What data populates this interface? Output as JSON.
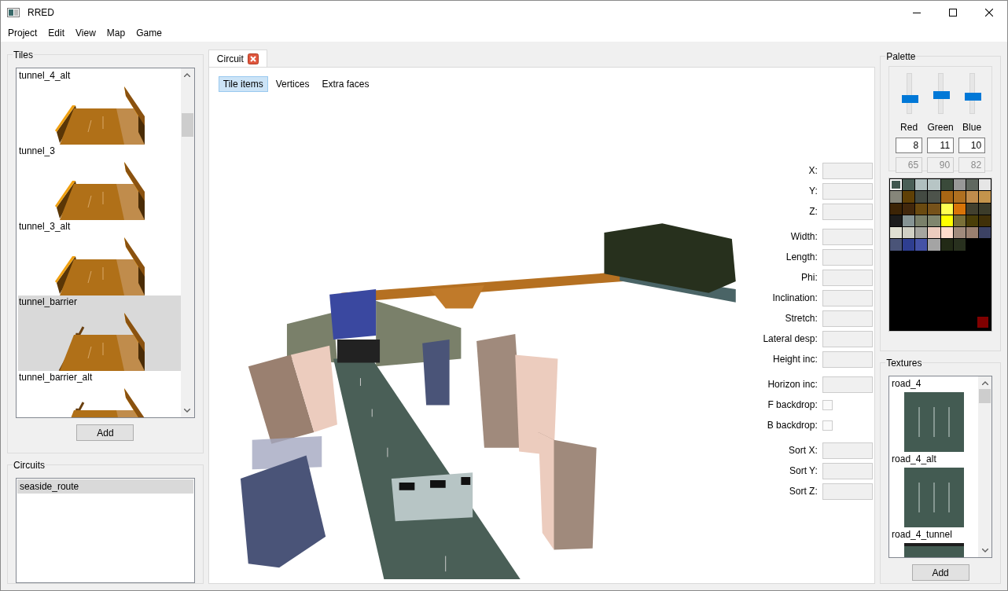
{
  "window": {
    "title": "RRED"
  },
  "menu": [
    "Project",
    "Edit",
    "View",
    "Map",
    "Game"
  ],
  "tiles": {
    "title": "Tiles",
    "items": [
      {
        "label": "tunnel_4_alt",
        "kind": "tunnel",
        "selected": false
      },
      {
        "label": "tunnel_3",
        "kind": "tunnel",
        "selected": false
      },
      {
        "label": "tunnel_3_alt",
        "kind": "tunnel",
        "selected": false
      },
      {
        "label": "tunnel_barrier",
        "kind": "barrier",
        "selected": true
      },
      {
        "label": "tunnel_barrier_alt",
        "kind": "barrier",
        "selected": false
      }
    ],
    "add_button": "Add"
  },
  "circuits": {
    "title": "Circuits",
    "items": [
      {
        "label": "seaside_route",
        "selected": true
      }
    ]
  },
  "editor": {
    "tab": {
      "label": "Circuit",
      "selected": true
    },
    "modes": [
      {
        "label": "Tile items",
        "selected": true
      },
      {
        "label": "Vertices",
        "selected": false
      },
      {
        "label": "Extra faces",
        "selected": false
      }
    ],
    "properties": [
      [
        {
          "label": "X:",
          "kind": "field"
        },
        {
          "label": "Y:",
          "kind": "field"
        },
        {
          "label": "Z:",
          "kind": "field"
        }
      ],
      [
        {
          "label": "Width:",
          "kind": "field"
        },
        {
          "label": "Length:",
          "kind": "field"
        },
        {
          "label": "Phi:",
          "kind": "field"
        },
        {
          "label": "Inclination:",
          "kind": "field"
        },
        {
          "label": "Stretch:",
          "kind": "field"
        },
        {
          "label": "Lateral desp:",
          "kind": "field"
        },
        {
          "label": "Height inc:",
          "kind": "field"
        }
      ],
      [
        {
          "label": "Horizon inc:",
          "kind": "field"
        },
        {
          "label": "F backdrop:",
          "kind": "checkbox",
          "checked": false
        },
        {
          "label": "B backdrop:",
          "kind": "checkbox",
          "checked": false
        }
      ],
      [
        {
          "label": "Sort X:",
          "kind": "field"
        },
        {
          "label": "Sort Y:",
          "kind": "field"
        },
        {
          "label": "Sort Z:",
          "kind": "field"
        }
      ]
    ]
  },
  "palette": {
    "title": "Palette",
    "channels": [
      {
        "name": "Red",
        "level": 0.35,
        "value": "8",
        "converted": "65"
      },
      {
        "name": "Green",
        "level": 0.47,
        "value": "11",
        "converted": "90"
      },
      {
        "name": "Blue",
        "level": 0.43,
        "value": "10",
        "converted": "82"
      }
    ],
    "swatches": [
      {
        "color": "#40574f",
        "selected": true
      },
      {
        "color": "#4a5f57",
        "selected": false
      },
      {
        "color": "#b0bfbf",
        "selected": false
      },
      {
        "color": "#b7c5c5",
        "selected": false
      },
      {
        "color": "#3a4a3a",
        "selected": false
      },
      {
        "color": "#989898",
        "selected": false
      },
      {
        "color": "#606860",
        "selected": false
      },
      {
        "color": "#e6e6e6",
        "selected": false
      },
      {
        "color": "#86867a",
        "selected": false
      },
      {
        "color": "#5f4006",
        "selected": false
      },
      {
        "color": "#434a42",
        "selected": false
      },
      {
        "color": "#4d534b",
        "selected": false
      },
      {
        "color": "#a86614",
        "selected": false
      },
      {
        "color": "#b07020",
        "selected": false
      },
      {
        "color": "#c08c4c",
        "selected": false
      },
      {
        "color": "#c4944c",
        "selected": false
      },
      {
        "color": "#3c2406",
        "selected": false
      },
      {
        "color": "#42280c",
        "selected": false
      },
      {
        "color": "#6a4a10",
        "selected": false
      },
      {
        "color": "#76521a",
        "selected": false
      },
      {
        "color": "#ffff50",
        "selected": false
      },
      {
        "color": "#d87408",
        "selected": false
      },
      {
        "color": "#42402e",
        "selected": false
      },
      {
        "color": "#3c3c2a",
        "selected": false
      },
      {
        "color": "#1c1c1c",
        "selected": false
      },
      {
        "color": "#869494",
        "selected": false
      },
      {
        "color": "#7a806a",
        "selected": false
      },
      {
        "color": "#80866e",
        "selected": false
      },
      {
        "color": "#ffff00",
        "selected": false
      },
      {
        "color": "#7a7038",
        "selected": false
      },
      {
        "color": "#4a3e08",
        "selected": false
      },
      {
        "color": "#403008",
        "selected": false
      },
      {
        "color": "#e0e0d2",
        "selected": false
      },
      {
        "color": "#d0d0c4",
        "selected": false
      },
      {
        "color": "#a6a6a0",
        "selected": false
      },
      {
        "color": "#ecccbe",
        "selected": false
      },
      {
        "color": "#ffdccc",
        "selected": false
      },
      {
        "color": "#a08a7c",
        "selected": false
      },
      {
        "color": "#9a8070",
        "selected": false
      },
      {
        "color": "#3c4264",
        "selected": false
      },
      {
        "color": "#4a5478",
        "selected": false
      },
      {
        "color": "#2e3e90",
        "selected": false
      },
      {
        "color": "#4452a6",
        "selected": false
      },
      {
        "color": "#a4a4a4",
        "selected": false
      },
      {
        "color": "#222a16",
        "selected": false
      },
      {
        "color": "#28301e",
        "selected": false
      }
    ],
    "corner_swatch": {
      "color": "#800000"
    }
  },
  "textures": {
    "title": "Textures",
    "items": [
      {
        "label": "road_4",
        "kind": "road"
      },
      {
        "label": "road_4_alt",
        "kind": "road"
      },
      {
        "label": "road_4_tunnel",
        "kind": "tunnel"
      }
    ],
    "add_button": "Add"
  }
}
